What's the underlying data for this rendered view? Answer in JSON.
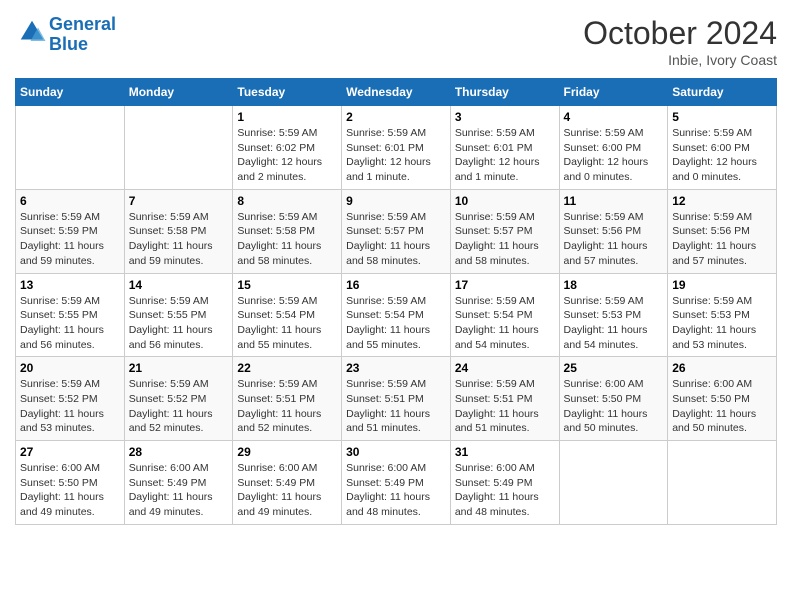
{
  "header": {
    "logo_line1": "General",
    "logo_line2": "Blue",
    "month": "October 2024",
    "location": "Inbie, Ivory Coast"
  },
  "days_of_week": [
    "Sunday",
    "Monday",
    "Tuesday",
    "Wednesday",
    "Thursday",
    "Friday",
    "Saturday"
  ],
  "weeks": [
    [
      {
        "day": "",
        "info": ""
      },
      {
        "day": "",
        "info": ""
      },
      {
        "day": "1",
        "info": "Sunrise: 5:59 AM\nSunset: 6:02 PM\nDaylight: 12 hours and 2 minutes."
      },
      {
        "day": "2",
        "info": "Sunrise: 5:59 AM\nSunset: 6:01 PM\nDaylight: 12 hours and 1 minute."
      },
      {
        "day": "3",
        "info": "Sunrise: 5:59 AM\nSunset: 6:01 PM\nDaylight: 12 hours and 1 minute."
      },
      {
        "day": "4",
        "info": "Sunrise: 5:59 AM\nSunset: 6:00 PM\nDaylight: 12 hours and 0 minutes."
      },
      {
        "day": "5",
        "info": "Sunrise: 5:59 AM\nSunset: 6:00 PM\nDaylight: 12 hours and 0 minutes."
      }
    ],
    [
      {
        "day": "6",
        "info": "Sunrise: 5:59 AM\nSunset: 5:59 PM\nDaylight: 11 hours and 59 minutes."
      },
      {
        "day": "7",
        "info": "Sunrise: 5:59 AM\nSunset: 5:58 PM\nDaylight: 11 hours and 59 minutes."
      },
      {
        "day": "8",
        "info": "Sunrise: 5:59 AM\nSunset: 5:58 PM\nDaylight: 11 hours and 58 minutes."
      },
      {
        "day": "9",
        "info": "Sunrise: 5:59 AM\nSunset: 5:57 PM\nDaylight: 11 hours and 58 minutes."
      },
      {
        "day": "10",
        "info": "Sunrise: 5:59 AM\nSunset: 5:57 PM\nDaylight: 11 hours and 58 minutes."
      },
      {
        "day": "11",
        "info": "Sunrise: 5:59 AM\nSunset: 5:56 PM\nDaylight: 11 hours and 57 minutes."
      },
      {
        "day": "12",
        "info": "Sunrise: 5:59 AM\nSunset: 5:56 PM\nDaylight: 11 hours and 57 minutes."
      }
    ],
    [
      {
        "day": "13",
        "info": "Sunrise: 5:59 AM\nSunset: 5:55 PM\nDaylight: 11 hours and 56 minutes."
      },
      {
        "day": "14",
        "info": "Sunrise: 5:59 AM\nSunset: 5:55 PM\nDaylight: 11 hours and 56 minutes."
      },
      {
        "day": "15",
        "info": "Sunrise: 5:59 AM\nSunset: 5:54 PM\nDaylight: 11 hours and 55 minutes."
      },
      {
        "day": "16",
        "info": "Sunrise: 5:59 AM\nSunset: 5:54 PM\nDaylight: 11 hours and 55 minutes."
      },
      {
        "day": "17",
        "info": "Sunrise: 5:59 AM\nSunset: 5:54 PM\nDaylight: 11 hours and 54 minutes."
      },
      {
        "day": "18",
        "info": "Sunrise: 5:59 AM\nSunset: 5:53 PM\nDaylight: 11 hours and 54 minutes."
      },
      {
        "day": "19",
        "info": "Sunrise: 5:59 AM\nSunset: 5:53 PM\nDaylight: 11 hours and 53 minutes."
      }
    ],
    [
      {
        "day": "20",
        "info": "Sunrise: 5:59 AM\nSunset: 5:52 PM\nDaylight: 11 hours and 53 minutes."
      },
      {
        "day": "21",
        "info": "Sunrise: 5:59 AM\nSunset: 5:52 PM\nDaylight: 11 hours and 52 minutes."
      },
      {
        "day": "22",
        "info": "Sunrise: 5:59 AM\nSunset: 5:51 PM\nDaylight: 11 hours and 52 minutes."
      },
      {
        "day": "23",
        "info": "Sunrise: 5:59 AM\nSunset: 5:51 PM\nDaylight: 11 hours and 51 minutes."
      },
      {
        "day": "24",
        "info": "Sunrise: 5:59 AM\nSunset: 5:51 PM\nDaylight: 11 hours and 51 minutes."
      },
      {
        "day": "25",
        "info": "Sunrise: 6:00 AM\nSunset: 5:50 PM\nDaylight: 11 hours and 50 minutes."
      },
      {
        "day": "26",
        "info": "Sunrise: 6:00 AM\nSunset: 5:50 PM\nDaylight: 11 hours and 50 minutes."
      }
    ],
    [
      {
        "day": "27",
        "info": "Sunrise: 6:00 AM\nSunset: 5:50 PM\nDaylight: 11 hours and 49 minutes."
      },
      {
        "day": "28",
        "info": "Sunrise: 6:00 AM\nSunset: 5:49 PM\nDaylight: 11 hours and 49 minutes."
      },
      {
        "day": "29",
        "info": "Sunrise: 6:00 AM\nSunset: 5:49 PM\nDaylight: 11 hours and 49 minutes."
      },
      {
        "day": "30",
        "info": "Sunrise: 6:00 AM\nSunset: 5:49 PM\nDaylight: 11 hours and 48 minutes."
      },
      {
        "day": "31",
        "info": "Sunrise: 6:00 AM\nSunset: 5:49 PM\nDaylight: 11 hours and 48 minutes."
      },
      {
        "day": "",
        "info": ""
      },
      {
        "day": "",
        "info": ""
      }
    ]
  ]
}
